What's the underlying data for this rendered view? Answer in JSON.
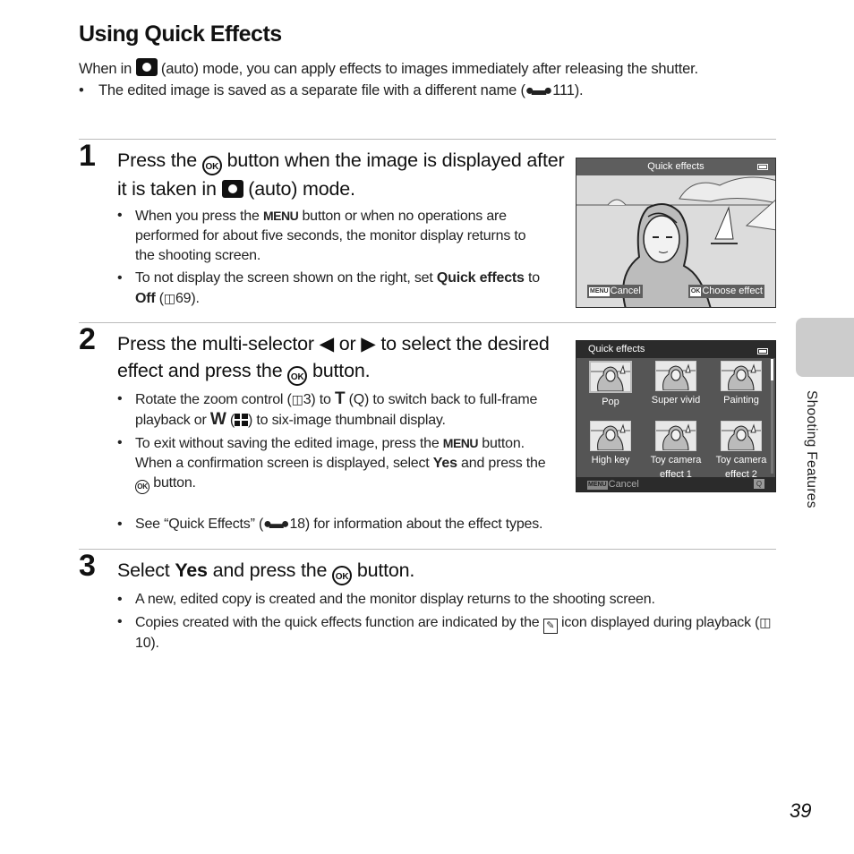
{
  "page": {
    "title": "Using Quick Effects",
    "intro": {
      "line_before_icon": "When in",
      "line_after_icon": "(auto) mode, you can apply effects to images immediately after releasing the shutter.",
      "bullet_before_ref": "The edited image is saved as a separate file with a different name (",
      "bullet_ref": "111",
      "bullet_after_ref": ")."
    },
    "steps": [
      {
        "number": "1",
        "head_a": "Press the",
        "head_b": "button when the image is displayed after it is taken in",
        "head_c": "(auto) mode.",
        "bullets": [
          {
            "a": "When you press the",
            "menu": "MENU",
            "b": "button or when no operations are performed for about five seconds, the monitor display returns to the shooting screen."
          },
          {
            "a": "To not display the screen shown on the right, set",
            "bold1": "Quick effects",
            "b": "to",
            "bold2": "Off",
            "c": "(",
            "ref": "69",
            "d": ")."
          }
        ]
      },
      {
        "number": "2",
        "head_a": "Press the multi-selector",
        "left_arrow": "◀",
        "or": "or",
        "right_arrow": "▶",
        "head_b": "to select the desired effect and press the",
        "head_c": "button.",
        "bullets": [
          {
            "a": "Rotate the zoom control (",
            "ref": "3",
            "b": ") to",
            "t": "T",
            "c": "(",
            "q": "Q",
            "d": ") to switch back to full-frame playback or",
            "w": "W",
            "e": "(",
            "f": ") to six-image thumbnail display."
          },
          {
            "a": "To exit without saving the edited image, press the",
            "menu": "MENU",
            "b": "button. When a confirmation screen is displayed, select",
            "yes": "Yes",
            "c": "and press the",
            "d": "button."
          },
          {
            "a": "See “Quick Effects” (",
            "ref": "18",
            "b": ") for information about the effect types."
          }
        ]
      },
      {
        "number": "3",
        "head_a": "Select",
        "head_bold": "Yes",
        "head_b": "and press the",
        "head_c": "button.",
        "bullets": [
          {
            "a": "A new, edited copy is created and the monitor display returns to the shooting screen."
          },
          {
            "a": "Copies created with the quick effects function are indicated by the",
            "b": "icon displayed during playback (",
            "ref": "10",
            "c": ")."
          }
        ]
      }
    ],
    "icons": {
      "ok": "OK",
      "book": "📖",
      "binoculars": "o-o"
    }
  },
  "screen1": {
    "title": "Quick effects",
    "cancel_tag": "MENU",
    "cancel": "Cancel",
    "choose_tag": "OK",
    "choose": "Choose effect"
  },
  "screen2": {
    "title": "Quick effects",
    "effects": [
      "Pop",
      "Super vivid",
      "Painting",
      "High key",
      "Toy camera effect 1",
      "Toy camera effect 2"
    ],
    "selected": "Pop",
    "cancel_tag": "MENU",
    "cancel": "Cancel",
    "zoom_icon": "Q"
  },
  "side": {
    "section": "Shooting Features"
  },
  "page_number": "39"
}
